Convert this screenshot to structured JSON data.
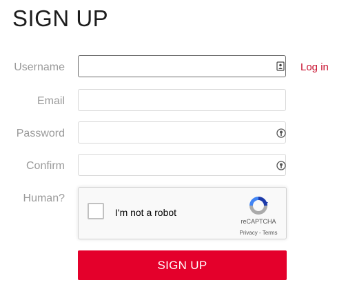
{
  "page_title": "SIGN UP",
  "form": {
    "username": {
      "label": "Username",
      "value": "",
      "placeholder": ""
    },
    "email": {
      "label": "Email",
      "value": "",
      "placeholder": ""
    },
    "password": {
      "label": "Password",
      "value": "",
      "placeholder": ""
    },
    "confirm": {
      "label": "Confirm",
      "value": "",
      "placeholder": ""
    },
    "human_label": "Human?"
  },
  "login_link": "Log in",
  "recaptcha": {
    "checkbox_label": "I'm not a robot",
    "brand": "reCAPTCHA",
    "privacy": "Privacy",
    "separator": " - ",
    "terms": "Terms"
  },
  "submit_label": "SIGN UP",
  "colors": {
    "accent": "#e4002b",
    "link": "#c8102e",
    "label": "#9a9a9a"
  },
  "icons": {
    "username_field": "contact-card-icon",
    "password_field": "password-manager-key-icon",
    "confirm_field": "password-manager-key-icon",
    "recaptcha": "recaptcha-logo-icon"
  }
}
